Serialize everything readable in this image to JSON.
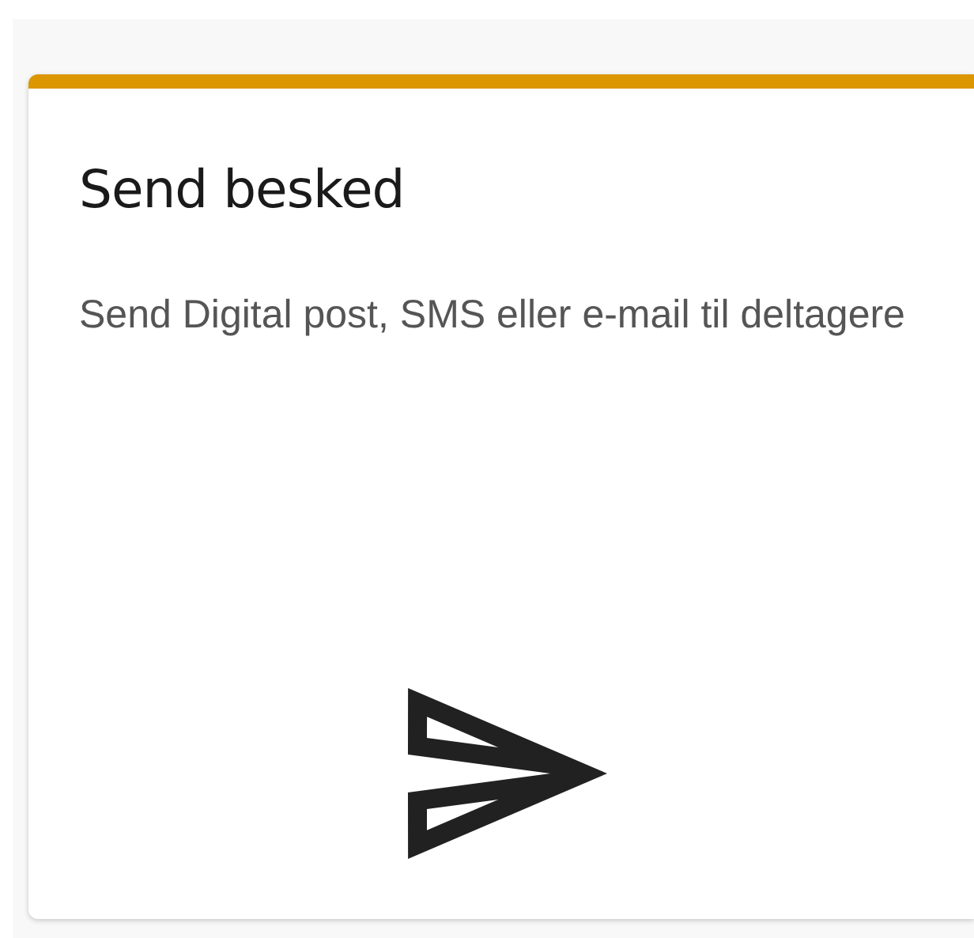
{
  "card": {
    "title": "Send besked",
    "description": "Send Digital post, SMS eller e-mail til deltagere"
  }
}
